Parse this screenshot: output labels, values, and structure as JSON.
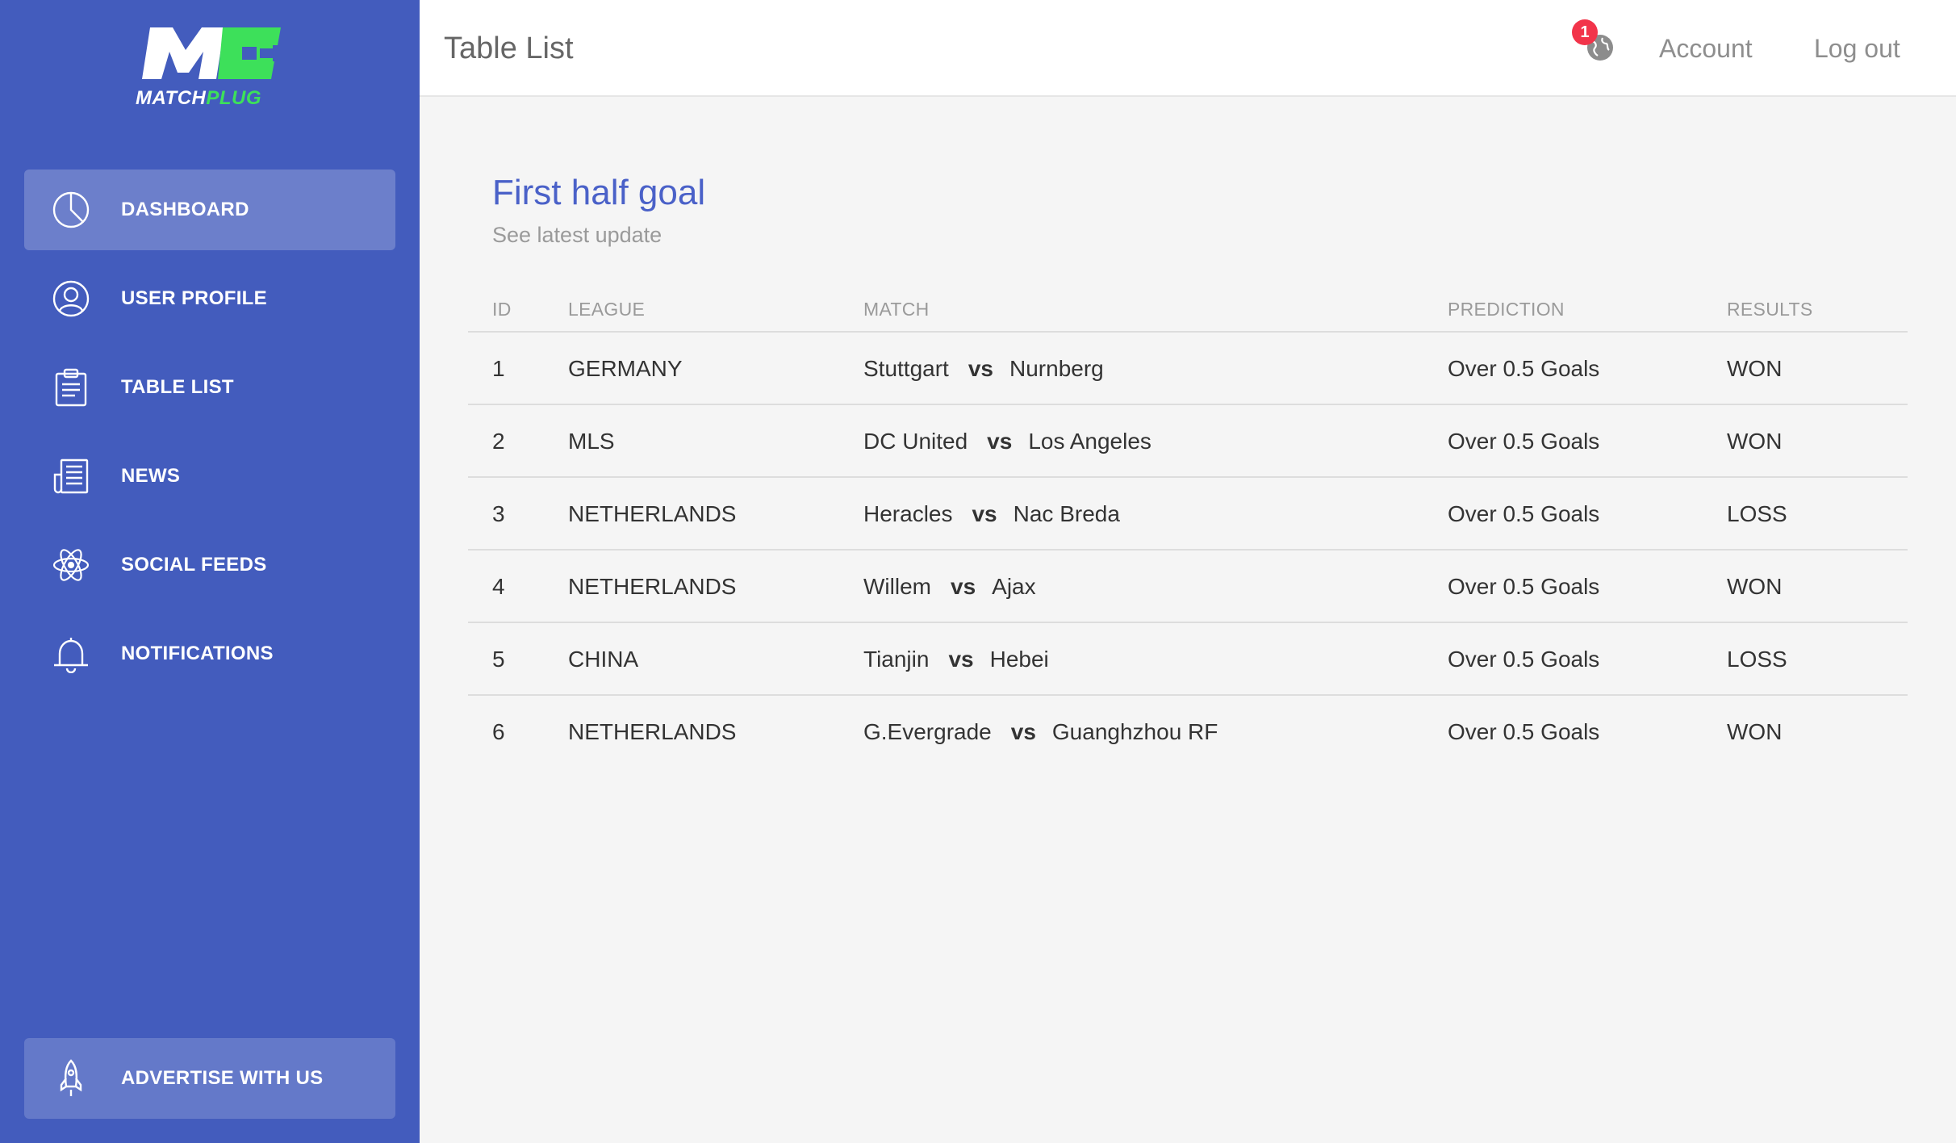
{
  "brand": {
    "word1": "MATCH",
    "word2": "PLUG",
    "mark": "MC",
    "accent": "#3de05a"
  },
  "sidebar": {
    "bg_color": "#435cbd",
    "items": [
      {
        "label": "DASHBOARD",
        "icon": "pie-chart-icon",
        "active": true
      },
      {
        "label": "USER PROFILE",
        "icon": "user-icon",
        "active": false
      },
      {
        "label": "TABLE LIST",
        "icon": "clipboard-icon",
        "active": false
      },
      {
        "label": "NEWS",
        "icon": "newspaper-icon",
        "active": false
      },
      {
        "label": "SOCIAL FEEDS",
        "icon": "atom-icon",
        "active": false
      },
      {
        "label": "NOTIFICATIONS",
        "icon": "bell-icon",
        "active": false
      }
    ],
    "advertise_label": "ADVERTISE WITH US",
    "advertise_icon": "rocket-icon"
  },
  "header": {
    "title": "Table List",
    "notification_count": "1",
    "notification_icon": "globe-icon",
    "account_label": "Account",
    "logout_label": "Log out"
  },
  "card": {
    "title": "First half goal",
    "subtitle": "See latest update",
    "title_color": "#4a61c8"
  },
  "table": {
    "columns": [
      "ID",
      "LEAGUE",
      "MATCH",
      "PREDICTION",
      "RESULTS"
    ],
    "rows": [
      {
        "id": "1",
        "league": "GERMANY",
        "home": "Stuttgart",
        "vs": "vs",
        "away": "Nurnberg",
        "prediction": "Over 0.5 Goals",
        "result": "WON"
      },
      {
        "id": "2",
        "league": "MLS",
        "home": "DC United",
        "vs": "vs",
        "away": "Los Angeles",
        "prediction": "Over 0.5 Goals",
        "result": "WON"
      },
      {
        "id": "3",
        "league": "NETHERLANDS",
        "home": "Heracles",
        "vs": "vs",
        "away": "Nac Breda",
        "prediction": "Over 0.5 Goals",
        "result": "LOSS"
      },
      {
        "id": "4",
        "league": "NETHERLANDS",
        "home": "Willem",
        "vs": "vs",
        "away": "Ajax",
        "prediction": "Over 0.5 Goals",
        "result": "WON"
      },
      {
        "id": "5",
        "league": "CHINA",
        "home": "Tianjin",
        "vs": "vs",
        "away": "Hebei",
        "prediction": "Over 0.5 Goals",
        "result": "LOSS"
      },
      {
        "id": "6",
        "league": "NETHERLANDS",
        "home": "G.Evergrade",
        "vs": "vs",
        "away": "Guanghzhou RF",
        "prediction": "Over 0.5 Goals",
        "result": "WON"
      }
    ]
  }
}
